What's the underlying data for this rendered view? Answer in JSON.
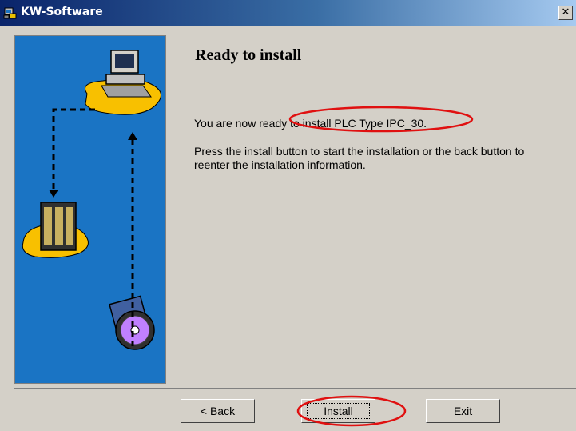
{
  "window": {
    "title": "KW-Software",
    "close_glyph": "✕"
  },
  "page": {
    "heading": "Ready to install",
    "line1_prefix": "You are now ready to install ",
    "product": "PLC Type IPC_30.",
    "line2": "Press the install button to start the installation or the back button to reenter the installation information."
  },
  "buttons": {
    "back_label": "< Back",
    "install_label": "Install",
    "exit_label": "Exit"
  },
  "icons": [
    "installer-app-icon",
    "computer-icon",
    "plc-device-icon",
    "cd-disk-icon"
  ],
  "colors": {
    "panel_bg": "#1a74c4",
    "annotation": "#e01010",
    "title_gradient_start": "#0a246a"
  }
}
